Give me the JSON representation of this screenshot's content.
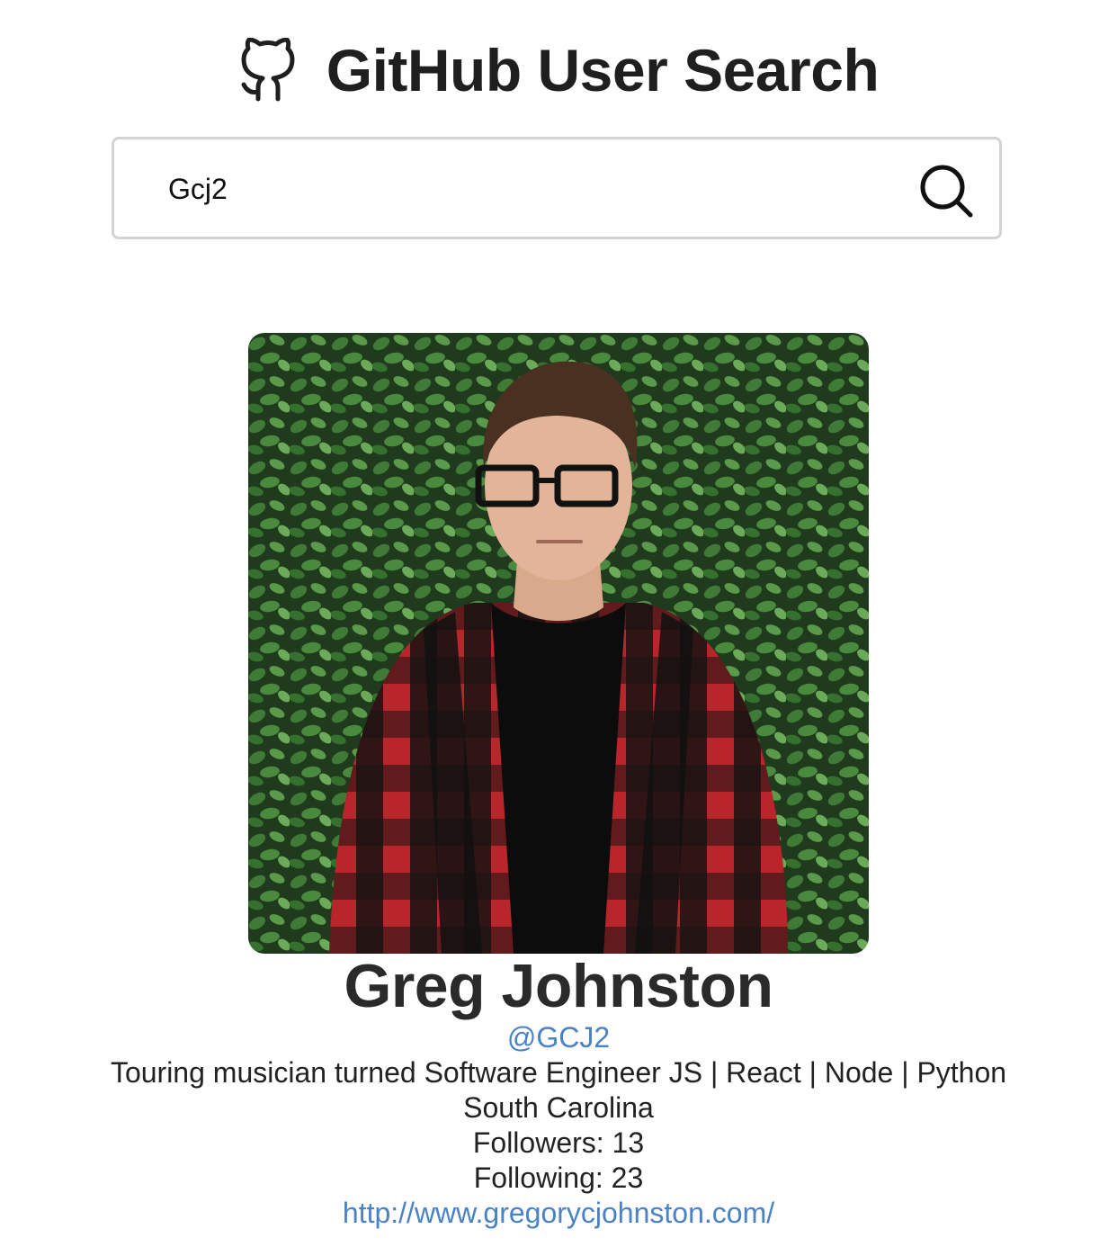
{
  "header": {
    "title": "GitHub User Search",
    "icon": "github-icon"
  },
  "search": {
    "value": "Gcj2",
    "icon": "search-icon"
  },
  "profile": {
    "photo_icon": "profile-photo",
    "name": "Greg Johnston",
    "handle": "@GCJ2",
    "bio": "Touring musician turned Software Engineer JS | React | Node | Python",
    "location": "South Carolina",
    "followers": "Followers: 13",
    "following": "Following: 23",
    "website": "http://www.gregorycjohnston.com/"
  },
  "colors": {
    "link": "#4a82c8",
    "text": "#222222",
    "border": "#d3d3d3"
  }
}
